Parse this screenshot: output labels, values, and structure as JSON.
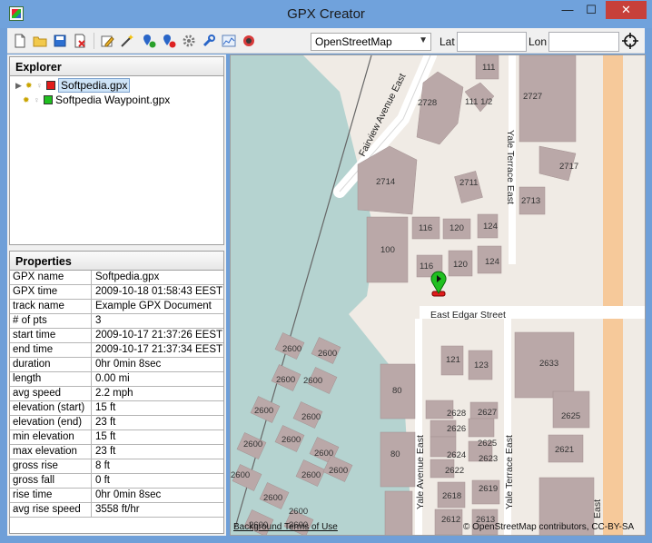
{
  "window": {
    "title": "GPX Creator",
    "minimize": "—",
    "maximize": "☐",
    "close": "✕"
  },
  "toolbar": {
    "map_source": "OpenStreetMap",
    "lat_label": "Lat",
    "lon_label": "Lon",
    "lat_value": "",
    "lon_value": "",
    "icons": [
      "new-file-icon",
      "open-folder-icon",
      "save-icon",
      "close-file-icon",
      "edit-icon",
      "magic-wand-icon",
      "add-waypoint-icon",
      "remove-waypoint-icon",
      "settings-gear-icon",
      "tools-icon",
      "chart-icon",
      "globe-icon",
      "crosshair-icon"
    ]
  },
  "explorer": {
    "title": "Explorer",
    "files": [
      {
        "name": "Softpedia.gpx",
        "color": "#e11c1c",
        "selected": true
      },
      {
        "name": "Softpedia Waypoint.gpx",
        "color": "#20c020",
        "selected": false
      }
    ]
  },
  "properties": {
    "title": "Properties",
    "rows": [
      {
        "key": "GPX name",
        "value": "Softpedia.gpx"
      },
      {
        "key": "GPX time",
        "value": "2009-10-18 01:58:43 EEST"
      },
      {
        "key": "track name",
        "value": "Example GPX Document"
      },
      {
        "key": "# of pts",
        "value": "3"
      },
      {
        "key": "start time",
        "value": "2009-10-17 21:37:26 EEST"
      },
      {
        "key": "end time",
        "value": "2009-10-17 21:37:34 EEST"
      },
      {
        "key": "duration",
        "value": "0hr 0min 8sec"
      },
      {
        "key": "length",
        "value": "0.00 mi"
      },
      {
        "key": "avg speed",
        "value": "2.2 mph"
      },
      {
        "key": "elevation (start)",
        "value": "15 ft"
      },
      {
        "key": "elevation (end)",
        "value": "23 ft"
      },
      {
        "key": "min elevation",
        "value": "15 ft"
      },
      {
        "key": "max elevation",
        "value": "23 ft"
      },
      {
        "key": "gross rise",
        "value": "8 ft"
      },
      {
        "key": "gross fall",
        "value": "0 ft"
      },
      {
        "key": "rise time",
        "value": "0hr 0min 8sec"
      },
      {
        "key": "avg rise speed",
        "value": "3558 ft/hr"
      }
    ]
  },
  "map": {
    "streets": [
      "Fairview Avenue East",
      "Yale Terrace East",
      "East Edgar Street",
      "Yale Avenue East",
      "Yale Terrace East",
      "East"
    ],
    "building_numbers": [
      "111",
      "2727",
      "2728",
      "111 1/2",
      "2717",
      "2714",
      "2711",
      "2713",
      "116",
      "120",
      "124",
      "100",
      "116",
      "120",
      "124",
      "2633",
      "121",
      "123",
      "80",
      "2628",
      "2627",
      "2625",
      "2626",
      "2625",
      "2621",
      "80",
      "2624",
      "2623",
      "2622",
      "2618",
      "2619",
      "2612",
      "2613",
      "2600",
      "2600",
      "2600",
      "2600",
      "2600",
      "2600",
      "2600",
      "2600",
      "2600",
      "2600",
      "2600",
      "2600",
      "2600",
      "2600",
      "2600",
      "2600"
    ],
    "footer_left": "Background Terms of Use",
    "footer_right": "© OpenStreetMap contributors, CC-BY-SA"
  }
}
